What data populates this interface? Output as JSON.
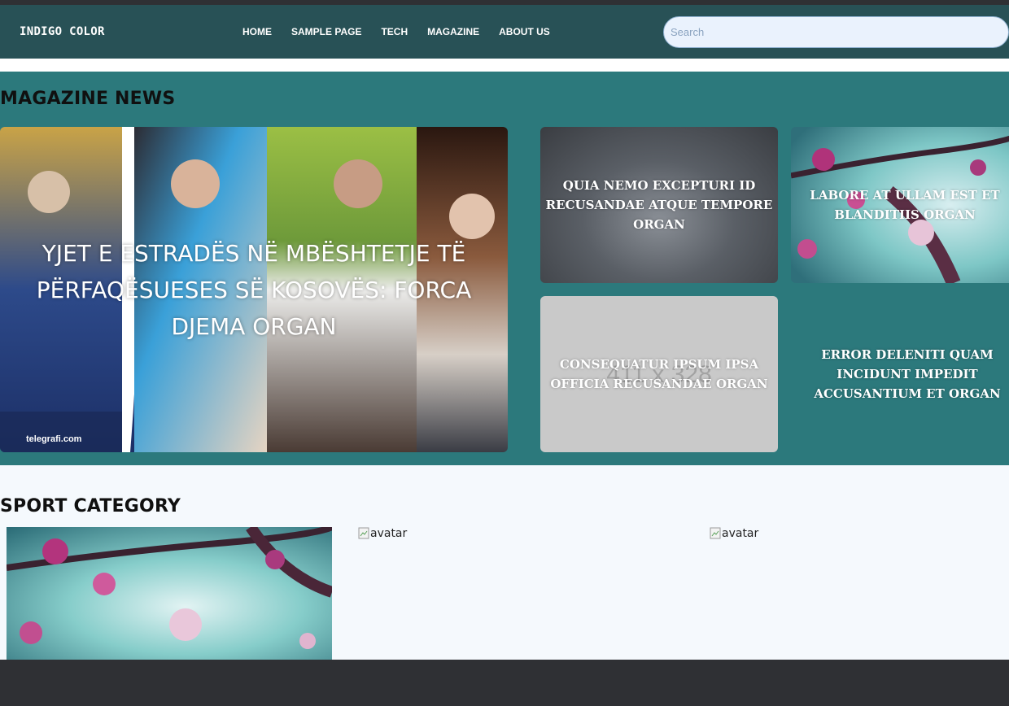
{
  "navbar": {
    "brand": "INDIGO COLOR",
    "links": [
      "HOME",
      "SAMPLE PAGE",
      "TECH",
      "MAGAZINE",
      "ABOUT US"
    ],
    "search_placeholder": "Search"
  },
  "magazine": {
    "title": "MAGAZINE NEWS",
    "featured": {
      "caption": "YJET E ESTRADËS NË MBËSHTETJE TË PËRFAQËSUESES SË KOSOVËS: FORCA DJEMA ORGAN",
      "watermark": "telegrafi.com"
    },
    "cards": [
      {
        "caption": "QUIA NEMO EXCEPTURI ID RECUSANDAE ATQUE TEMPORE ORGAN"
      },
      {
        "caption": "LABORE AT ULLAM EST ET BLANDITIIS ORGAN"
      },
      {
        "caption": "CONSEQUATUR IPSUM IPSA OFFICIA RECUSANDAE ORGAN",
        "placeholder": "411 x 328"
      },
      {
        "caption": "ERROR DELENITI QUAM INCIDUNT IMPEDIT ACCUSANTIUM ET ORGAN"
      }
    ]
  },
  "sport": {
    "title": "SPORT CATEGORY",
    "broken_images": [
      "avatar",
      "avatar"
    ]
  },
  "colors": {
    "navbar": "#285156",
    "magazine_bg": "#2c797c",
    "sport_bg": "#f5f9fd",
    "footer": "#2f3034"
  }
}
